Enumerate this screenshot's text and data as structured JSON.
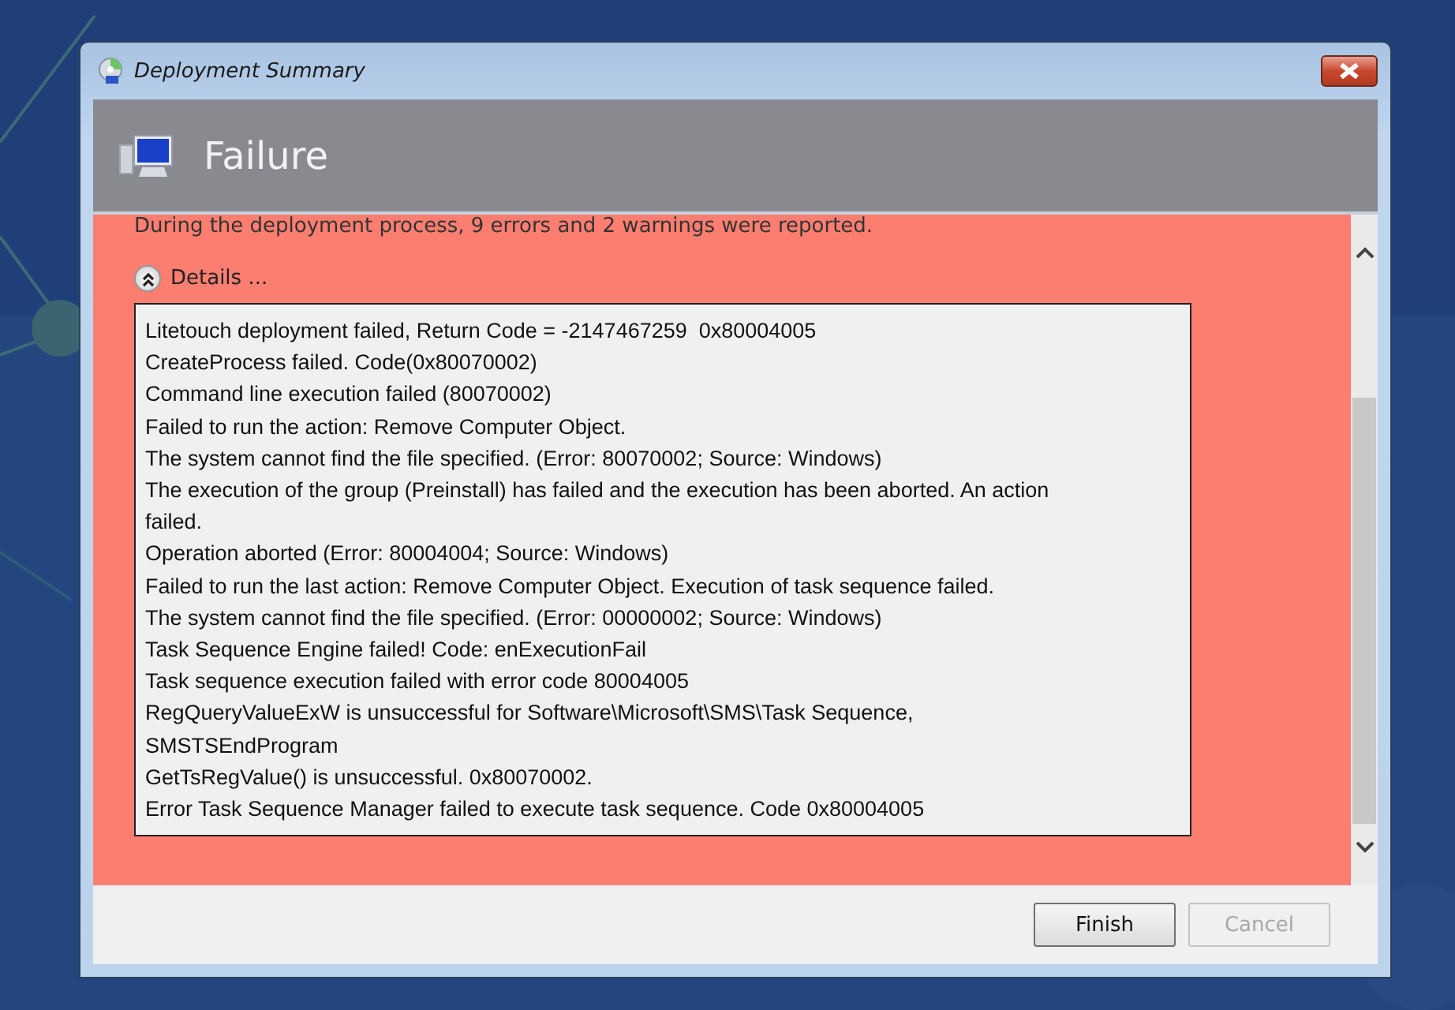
{
  "window": {
    "title": "Deployment Summary"
  },
  "header": {
    "title": "Failure"
  },
  "summary": "During the deployment process, 9 errors and 2 warnings were reported.",
  "details": {
    "label": "Details ...",
    "expanded": true,
    "lines": [
      "Litetouch deployment failed, Return Code = -2147467259  0x80004005",
      "CreateProcess failed. Code(0x80070002)",
      "Command line execution failed (80070002)",
      "Failed to run the action: Remove Computer Object.",
      "The system cannot find the file specified. (Error: 80070002; Source: Windows)",
      "The execution of the group (Preinstall) has failed and the execution has been aborted. An action",
      "failed.",
      "Operation aborted (Error: 80004004; Source: Windows)",
      "Failed to run the last action: Remove Computer Object. Execution of task sequence failed.",
      "The system cannot find the file specified. (Error: 00000002; Source: Windows)",
      "Task Sequence Engine failed! Code: enExecutionFail",
      "Task sequence execution failed with error code 80004005",
      "RegQueryValueExW is unsuccessful for Software\\Microsoft\\SMS\\Task Sequence,",
      "SMSTSEndProgram",
      "GetTsRegValue() is unsuccessful. 0x80070002.",
      "Error Task Sequence Manager failed to execute task sequence. Code 0x80004005"
    ]
  },
  "buttons": [
    {
      "label": "Finish",
      "disabled": false
    },
    {
      "label": "Cancel",
      "disabled": true
    }
  ]
}
